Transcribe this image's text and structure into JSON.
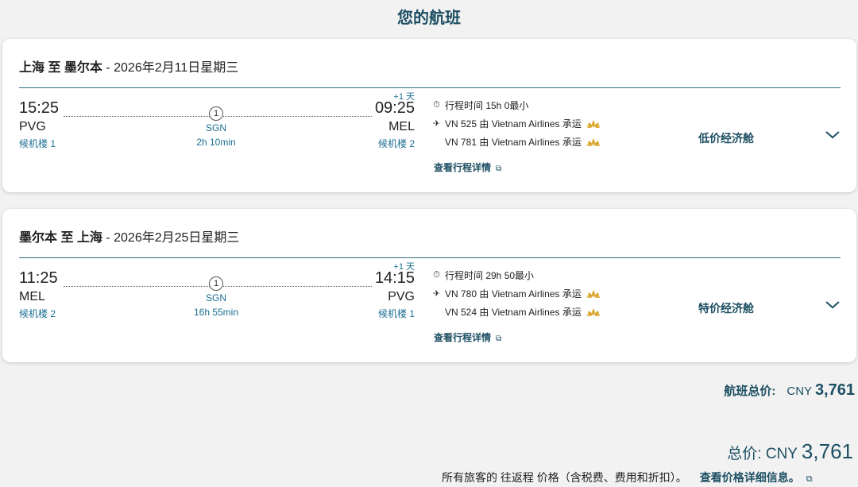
{
  "page": {
    "title": "您的航班"
  },
  "itineraries": [
    {
      "header_route": "上海 至 墨尔本",
      "header_date": " - 2026年2月11日星期三",
      "dep_time": "15:25",
      "dep_airport": "PVG",
      "dep_terminal": "候机楼 1",
      "arr_time": "09:25",
      "arr_airport": "MEL",
      "arr_terminal": "候机楼 2",
      "plus_day": "+1 天",
      "stops": "1",
      "stop_airport": "SGN",
      "stop_duration": "2h 10min",
      "duration_text": "行程时间 15h 0最小",
      "flights": [
        {
          "text": "VN 525  由 Vietnam Airlines 承运"
        },
        {
          "text": "VN 781  由 Vietnam Airlines 承运"
        }
      ],
      "details_link": "查看行程详情",
      "cabin": "低价经济舱"
    },
    {
      "header_route": "墨尔本 至 上海",
      "header_date": " - 2026年2月25日星期三",
      "dep_time": "11:25",
      "dep_airport": "MEL",
      "dep_terminal": "候机楼 2",
      "arr_time": "14:15",
      "arr_airport": "PVG",
      "arr_terminal": "候机楼 1",
      "plus_day": "+1 天",
      "stops": "1",
      "stop_airport": "SGN",
      "stop_duration": "16h 55min",
      "duration_text": "行程时间 29h 50最小",
      "flights": [
        {
          "text": "VN 780  由 Vietnam Airlines 承运"
        },
        {
          "text": "VN 524  由 Vietnam Airlines 承运"
        }
      ],
      "details_link": "查看行程详情",
      "cabin": "特价经济舱"
    }
  ],
  "flight_total": {
    "label": "航班总价:",
    "currency": "CNY",
    "amount": "3,761"
  },
  "grand_total": {
    "label": "总价: CNY",
    "amount": "3,761"
  },
  "footnote": {
    "text": "所有旅客的 往返程 价格（含税费、费用和折扣）。",
    "link": "查看价格详细信息。"
  },
  "icons": {
    "clock": "stopwatch-icon",
    "plane": "plane-icon",
    "lotus": "vietnam-airlines-lotus-icon",
    "external": "external-link-icon",
    "chevron": "chevron-down-icon"
  },
  "colors": {
    "accent": "#1d4f63",
    "link": "#1a6f92",
    "gold": "#d9a427"
  }
}
